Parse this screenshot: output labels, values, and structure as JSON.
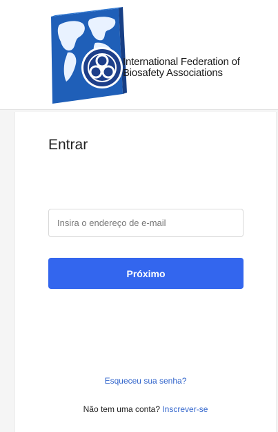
{
  "logo": {
    "line1": "International Federation of",
    "line2": "Biosafety Associations",
    "icon": "biohazard-globe-logo"
  },
  "login": {
    "title": "Entrar",
    "email_placeholder": "Insira o endereço de e-mail",
    "next_label": "Próximo",
    "forgot_label": "Esqueceu sua senha?",
    "no_account_label": "Não tem uma conta?",
    "signup_label": "Inscrever-se"
  },
  "colors": {
    "primary_button": "#3366ee",
    "link": "#3366cc"
  }
}
